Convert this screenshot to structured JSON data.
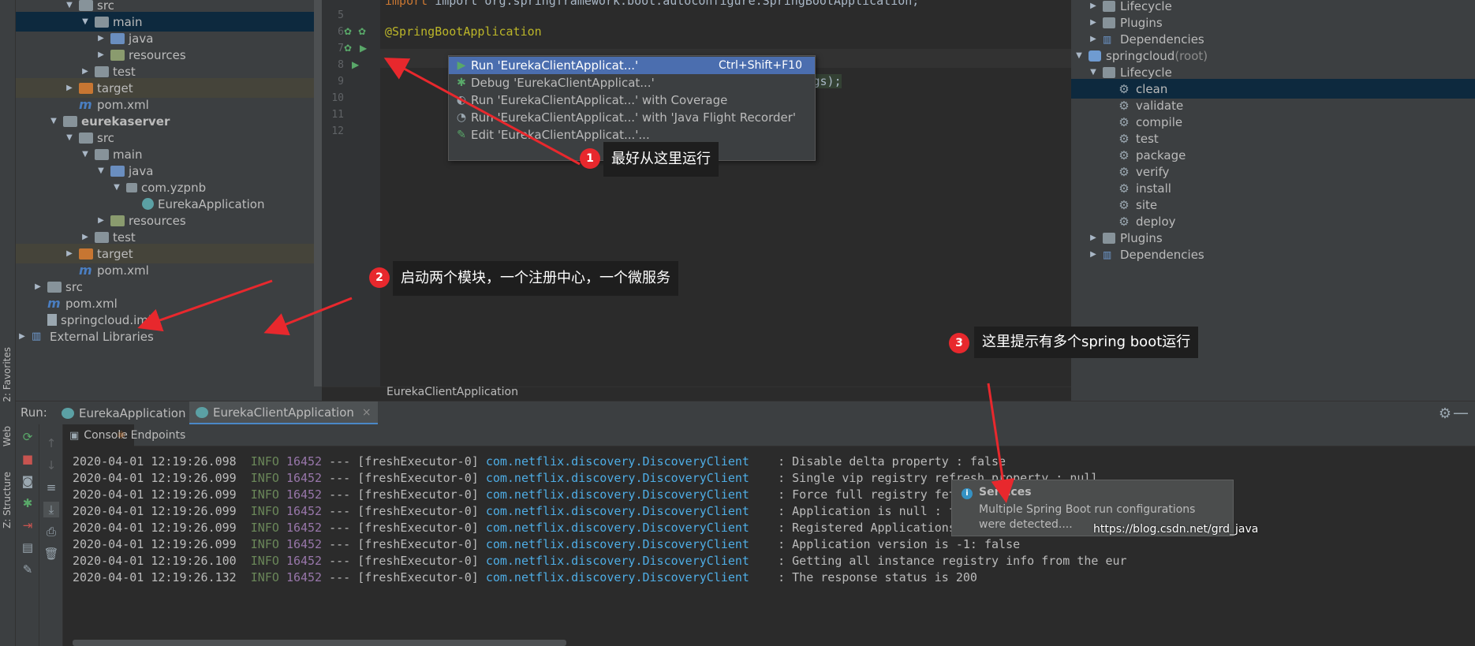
{
  "left_stripe": {
    "favorites": "2: Favorites",
    "web": "Web",
    "structure": "Z: Structure"
  },
  "project_tree": {
    "rows": [
      {
        "label": "src",
        "arrow": "▼",
        "icon": "folder",
        "indent": 60,
        "state": ""
      },
      {
        "label": "main",
        "arrow": "▼",
        "icon": "folder",
        "indent": 80,
        "state": "selected"
      },
      {
        "label": "java",
        "arrow": "▶",
        "icon": "src",
        "indent": 100,
        "state": ""
      },
      {
        "label": "resources",
        "arrow": "▶",
        "icon": "res",
        "indent": 100,
        "state": ""
      },
      {
        "label": "test",
        "arrow": "▶",
        "icon": "folder",
        "indent": 80,
        "state": ""
      },
      {
        "label": "target",
        "arrow": "▶",
        "icon": "target",
        "indent": 60,
        "state": "excluded"
      },
      {
        "label": "pom.xml",
        "arrow": "",
        "icon": "mfile",
        "indent": 60,
        "state": ""
      },
      {
        "label": "eurekaserver",
        "arrow": "▼",
        "icon": "folder",
        "indent": 40,
        "state": "bold"
      },
      {
        "label": "src",
        "arrow": "▼",
        "icon": "folder",
        "indent": 60,
        "state": ""
      },
      {
        "label": "main",
        "arrow": "▼",
        "icon": "folder",
        "indent": 80,
        "state": ""
      },
      {
        "label": "java",
        "arrow": "▼",
        "icon": "src",
        "indent": 100,
        "state": ""
      },
      {
        "label": "com.yzpnb",
        "arrow": "▼",
        "icon": "pkg",
        "indent": 120,
        "state": ""
      },
      {
        "label": "EurekaApplication",
        "arrow": "",
        "icon": "spring",
        "indent": 140,
        "state": ""
      },
      {
        "label": "resources",
        "arrow": "▶",
        "icon": "res",
        "indent": 100,
        "state": ""
      },
      {
        "label": "test",
        "arrow": "▶",
        "icon": "folder",
        "indent": 80,
        "state": ""
      },
      {
        "label": "target",
        "arrow": "▶",
        "icon": "target",
        "indent": 60,
        "state": "excluded"
      },
      {
        "label": "pom.xml",
        "arrow": "",
        "icon": "mfile",
        "indent": 60,
        "state": ""
      },
      {
        "label": "src",
        "arrow": "▶",
        "icon": "folder",
        "indent": 20,
        "state": ""
      },
      {
        "label": "pom.xml",
        "arrow": "",
        "icon": "mfile",
        "indent": 20,
        "state": ""
      },
      {
        "label": "springcloud.iml",
        "arrow": "",
        "icon": "iml",
        "indent": 20,
        "state": ""
      },
      {
        "label": "External Libraries",
        "arrow": "▶",
        "icon": "lib",
        "indent": 0,
        "state": ""
      }
    ]
  },
  "editor": {
    "lines": [
      {
        "no": "5",
        "code": ""
      },
      {
        "no": "6",
        "code": "@SpringBootApplication"
      },
      {
        "no": "7",
        "code": ""
      },
      {
        "no": "8",
        "code": ""
      },
      {
        "no": "9",
        "code": "ication.class,args);"
      },
      {
        "no": "10",
        "code": ""
      },
      {
        "no": "11",
        "code": ""
      },
      {
        "no": "12",
        "code": ""
      }
    ],
    "top_line": "import org.springframework.boot.autoconfigure.SpringBootApplication;",
    "breadcrumb": "EurekaClientApplication"
  },
  "run_menu": {
    "items": [
      {
        "label": "Run 'EurekaClientApplicat...'",
        "shortcut": "Ctrl+Shift+F10",
        "icon": "▶",
        "color": "#59a869",
        "active": true
      },
      {
        "label": "Debug 'EurekaClientApplicat...'",
        "shortcut": "",
        "icon": "✱",
        "color": "#59a869",
        "active": false
      },
      {
        "label": "Run 'EurekaClientApplicat...' with Coverage",
        "shortcut": "",
        "icon": "◐",
        "color": "#9aa7b0",
        "active": false
      },
      {
        "label": "Run 'EurekaClientApplicat...' with 'Java Flight Recorder'",
        "shortcut": "",
        "icon": "◔",
        "color": "#9aa7b0",
        "active": false
      },
      {
        "label": "Edit 'EurekaClientApplicat...'...",
        "shortcut": "",
        "icon": "✎",
        "color": "#59a869",
        "active": false
      }
    ]
  },
  "callouts": [
    {
      "num": "1",
      "text": "最好从这里运行"
    },
    {
      "num": "2",
      "text": "启动两个模块，一个注册中心，一个微服务"
    },
    {
      "num": "3",
      "text": "这里提示有多个spring boot运行"
    }
  ],
  "maven": {
    "rows": [
      {
        "label": "Lifecycle",
        "arrow": "▶",
        "icon": "folder",
        "indent": 22
      },
      {
        "label": "Plugins",
        "arrow": "▶",
        "icon": "folder",
        "indent": 22
      },
      {
        "label": "Dependencies",
        "arrow": "▶",
        "icon": "bars",
        "indent": 22
      },
      {
        "label": "springcloud",
        "suffix": " (root)",
        "arrow": "▼",
        "icon": "proj",
        "indent": 4
      },
      {
        "label": "Lifecycle",
        "arrow": "▼",
        "icon": "folder",
        "indent": 22
      },
      {
        "label": "clean",
        "arrow": "",
        "icon": "gear",
        "indent": 58,
        "selected": true
      },
      {
        "label": "validate",
        "arrow": "",
        "icon": "gear",
        "indent": 58
      },
      {
        "label": "compile",
        "arrow": "",
        "icon": "gear",
        "indent": 58
      },
      {
        "label": "test",
        "arrow": "",
        "icon": "gear",
        "indent": 58
      },
      {
        "label": "package",
        "arrow": "",
        "icon": "gear",
        "indent": 58
      },
      {
        "label": "verify",
        "arrow": "",
        "icon": "gear",
        "indent": 58
      },
      {
        "label": "install",
        "arrow": "",
        "icon": "gear",
        "indent": 58
      },
      {
        "label": "site",
        "arrow": "",
        "icon": "gear",
        "indent": 58
      },
      {
        "label": "deploy",
        "arrow": "",
        "icon": "gear",
        "indent": 58
      },
      {
        "label": "Plugins",
        "arrow": "▶",
        "icon": "folder",
        "indent": 22
      },
      {
        "label": "Dependencies",
        "arrow": "▶",
        "icon": "bars",
        "indent": 22
      }
    ]
  },
  "run_window": {
    "title": "Run:",
    "tabs": [
      {
        "label": "EurekaApplication",
        "active": false
      },
      {
        "label": "EurekaClientApplication",
        "active": true
      }
    ],
    "console_tabs": [
      {
        "label": "Console",
        "icon": "▣",
        "active": true
      },
      {
        "label": "Endpoints",
        "icon": "⚛",
        "active": false
      }
    ]
  },
  "console": {
    "lines": [
      {
        "ts": "2020-04-01 12:19:26.098",
        "level": "INFO",
        "pid": "16452",
        "thread": "--- [freshExecutor-0]",
        "cls": "com.netflix.discovery.DiscoveryClient",
        "msg": ": Disable delta property : false"
      },
      {
        "ts": "2020-04-01 12:19:26.099",
        "level": "INFO",
        "pid": "16452",
        "thread": "--- [freshExecutor-0]",
        "cls": "com.netflix.discovery.DiscoveryClient",
        "msg": ": Single vip registry refresh property : null"
      },
      {
        "ts": "2020-04-01 12:19:26.099",
        "level": "INFO",
        "pid": "16452",
        "thread": "--- [freshExecutor-0]",
        "cls": "com.netflix.discovery.DiscoveryClient",
        "msg": ": Force full registry fetch : false"
      },
      {
        "ts": "2020-04-01 12:19:26.099",
        "level": "INFO",
        "pid": "16452",
        "thread": "--- [freshExecutor-0]",
        "cls": "com.netflix.discovery.DiscoveryClient",
        "msg": ": Application is null : false"
      },
      {
        "ts": "2020-04-01 12:19:26.099",
        "level": "INFO",
        "pid": "16452",
        "thread": "--- [freshExecutor-0]",
        "cls": "com.netflix.discovery.DiscoveryClient",
        "msg": ": Registered Applications size is zero : true"
      },
      {
        "ts": "2020-04-01 12:19:26.099",
        "level": "INFO",
        "pid": "16452",
        "thread": "--- [freshExecutor-0]",
        "cls": "com.netflix.discovery.DiscoveryClient",
        "msg": ": Application version is -1: false"
      },
      {
        "ts": "2020-04-01 12:19:26.100",
        "level": "INFO",
        "pid": "16452",
        "thread": "--- [freshExecutor-0]",
        "cls": "com.netflix.discovery.DiscoveryClient",
        "msg": ": Getting all instance registry info from the eur"
      },
      {
        "ts": "2020-04-01 12:19:26.132",
        "level": "INFO",
        "pid": "16452",
        "thread": "--- [freshExecutor-0]",
        "cls": "com.netflix.discovery.DiscoveryClient",
        "msg": ": The response status is 200"
      }
    ]
  },
  "notification": {
    "title": "Services",
    "body": "Multiple Spring Boot run configurations were detected...."
  },
  "watermark": "https://blog.csdn.net/grd_java",
  "colors": {
    "accent": "#4b6eaf",
    "callout": "#e8282d"
  }
}
